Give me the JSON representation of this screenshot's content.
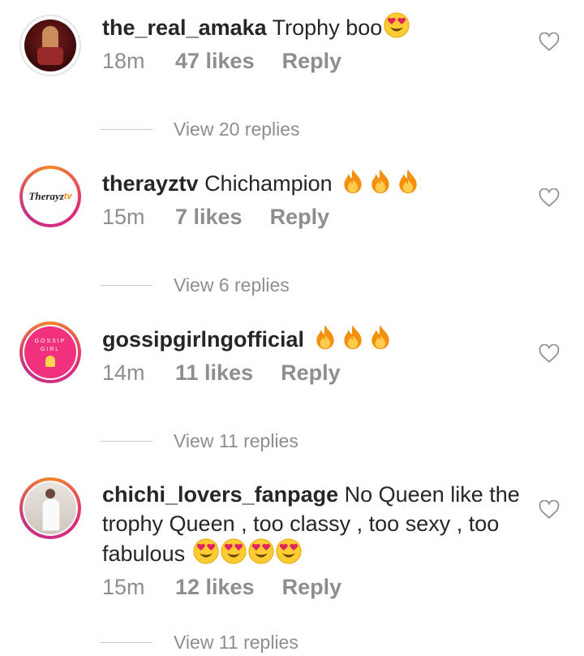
{
  "comments": [
    {
      "username": "the_real_amaka",
      "text": "Trophy boo",
      "emojis": [
        "heart-eyes"
      ],
      "time": "18m",
      "likes": "47 likes",
      "reply": "Reply",
      "view_replies": "View 20 replies"
    },
    {
      "username": "therayztv",
      "text": "Chichampion",
      "emojis": [
        "fire",
        "fire",
        "fire"
      ],
      "time": "15m",
      "likes": "7 likes",
      "reply": "Reply",
      "view_replies": "View 6 replies",
      "avatar_logo_text": "Therayz"
    },
    {
      "username": "gossipgirlngofficial",
      "text": "",
      "emojis": [
        "fire",
        "fire",
        "fire"
      ],
      "time": "14m",
      "likes": "11 likes",
      "reply": "Reply",
      "view_replies": "View 11 replies",
      "avatar_logo_text": "GOSSIP GIRL"
    },
    {
      "username": "chichi_lovers_fanpage",
      "text_line1": "No Queen like the",
      "text_line2": "trophy Queen , too classy , too sexy , too",
      "text_line3": "fabulous",
      "emojis": [
        "heart-eyes",
        "heart-eyes",
        "heart-eyes",
        "heart-eyes"
      ],
      "time": "15m",
      "likes": "12 likes",
      "reply": "Reply",
      "view_replies": "View 11 replies"
    }
  ],
  "colors": {
    "text": "#262626",
    "muted": "#8e8e8e",
    "gossip_pink": "#f2317e"
  }
}
